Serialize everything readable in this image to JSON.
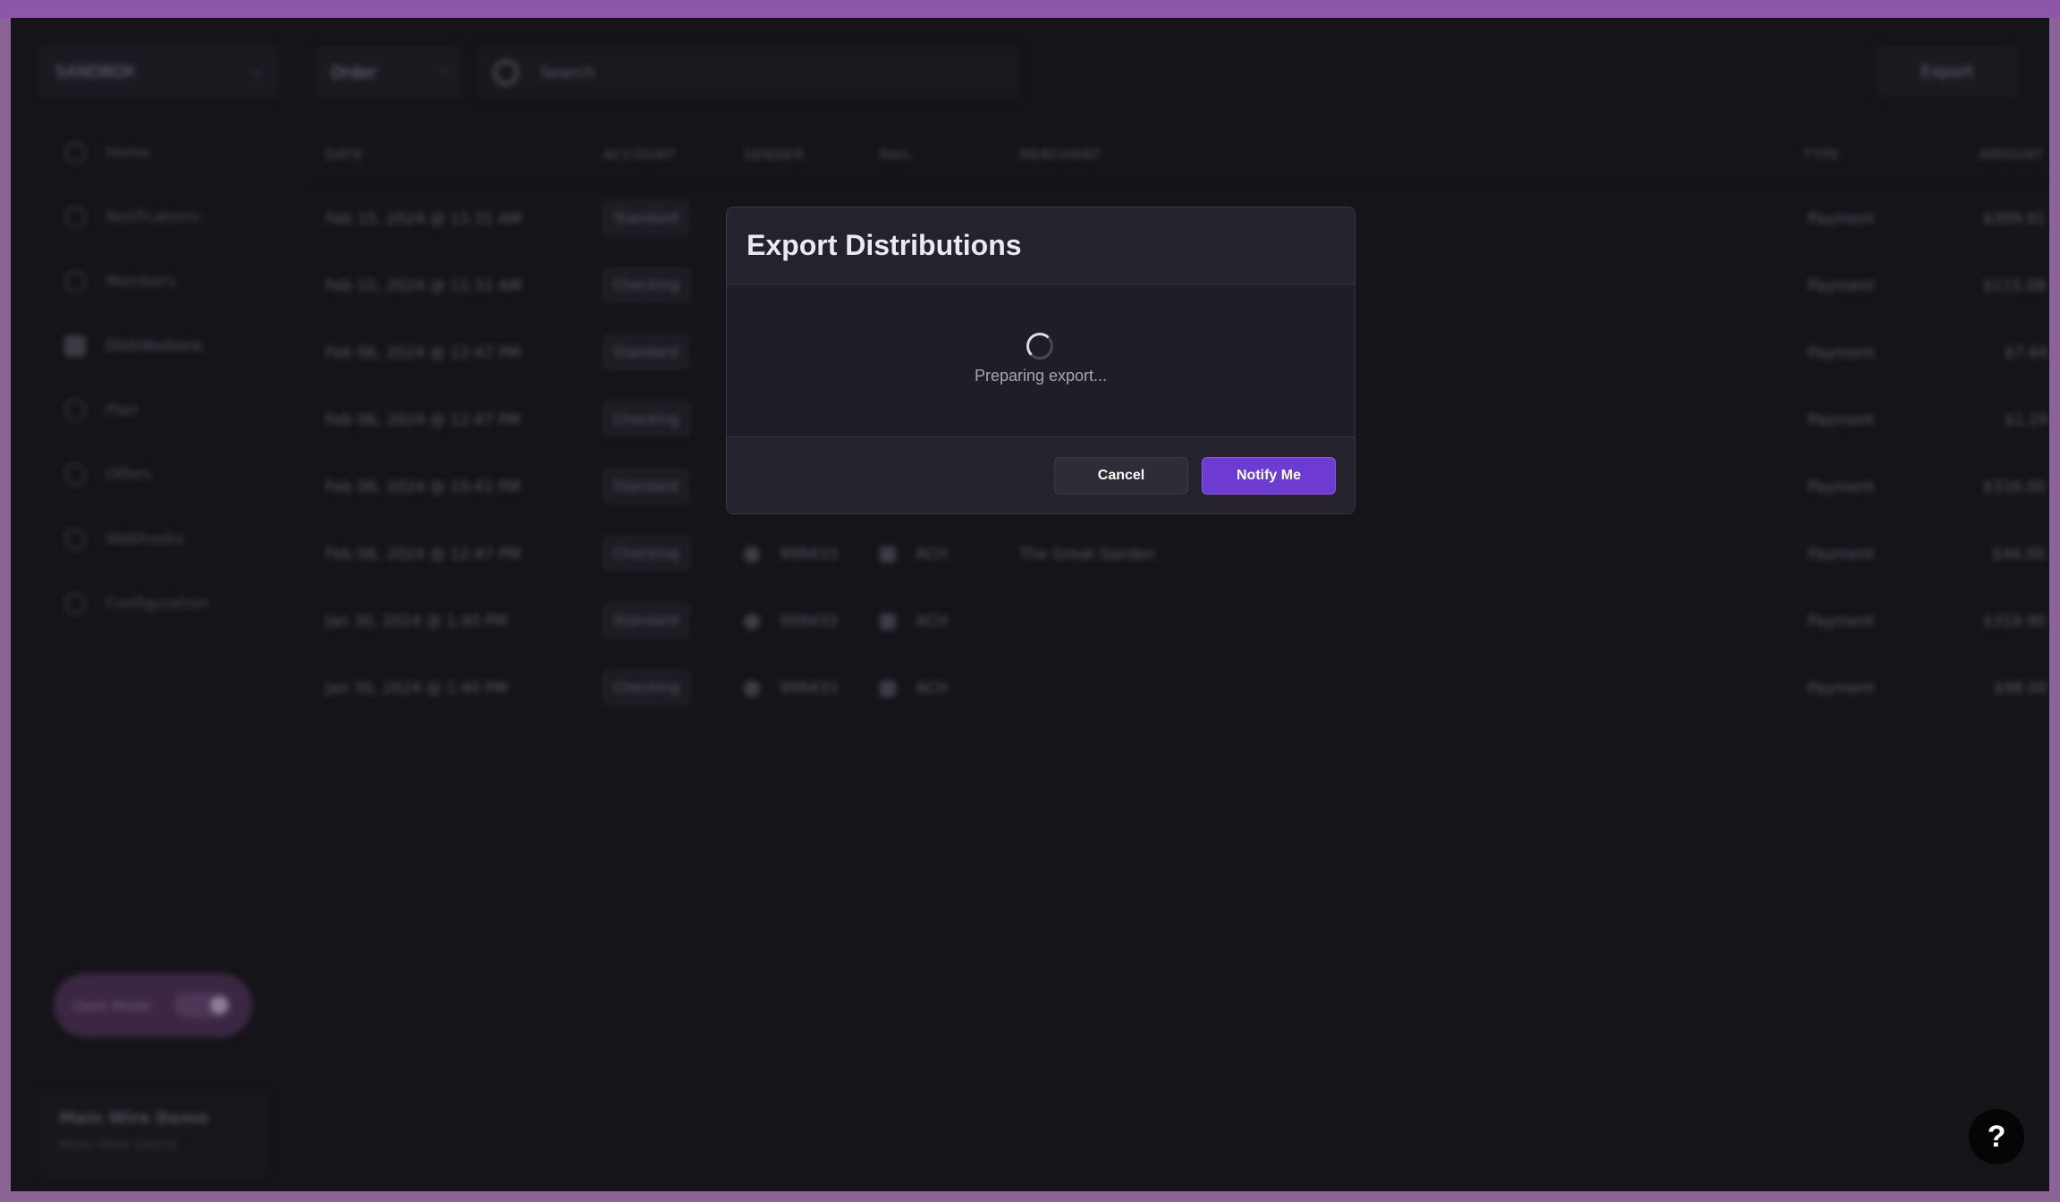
{
  "background": {
    "workspace_select": "SANDBOX",
    "order_select": "Order",
    "search_placeholder": "Search",
    "export_label": "Export",
    "nav": [
      {
        "label": "Home",
        "icon": "home-icon"
      },
      {
        "label": "Notifications",
        "icon": "bell-icon"
      },
      {
        "label": "Members",
        "icon": "members-icon"
      },
      {
        "label": "Distributions",
        "icon": "distributions-icon"
      },
      {
        "label": "Plan",
        "icon": "plan-icon"
      },
      {
        "label": "Offers",
        "icon": "offers-icon"
      },
      {
        "label": "Webhooks",
        "icon": "webhooks-icon"
      },
      {
        "label": "Configuration",
        "icon": "configuration-icon"
      }
    ],
    "columns": [
      "DATE",
      "ACCOUNT",
      "SENDER",
      "RAIL",
      "MERCHANT",
      "TYPE",
      "AMOUNT"
    ],
    "rows": [
      {
        "date": "Feb 15, 2024 @ 11:31 AM",
        "account": "Standard",
        "sender": "",
        "rail": "",
        "merchant": "",
        "type": "Payment",
        "amount": "$309.91"
      },
      {
        "date": "Feb 15, 2024 @ 11:31 AM",
        "account": "Checking",
        "sender": "",
        "rail": "",
        "merchant": "",
        "type": "Payment",
        "amount": "$115.08"
      },
      {
        "date": "Feb 06, 2024 @ 12:47 PM",
        "account": "Standard",
        "sender": "",
        "rail": "",
        "merchant": "",
        "type": "Payment",
        "amount": "$7.84"
      },
      {
        "date": "Feb 06, 2024 @ 12:47 PM",
        "account": "Checking",
        "sender": "",
        "rail": "",
        "merchant": "",
        "type": "Payment",
        "amount": "$1.29"
      },
      {
        "date": "Feb 06, 2024 @ 10:41 PM",
        "account": "Standard",
        "sender": "",
        "rail": "",
        "merchant": "",
        "type": "Payment",
        "amount": "$316.00"
      },
      {
        "date": "Feb 06, 2024 @ 12:47 PM",
        "account": "Checking",
        "sender": "999433",
        "rail": "ACH",
        "merchant": "The Great Garden",
        "type": "Payment",
        "amount": "$44.00"
      },
      {
        "date": "Jan 30, 2024 @ 1:40 PM",
        "account": "Standard",
        "sender": "999433",
        "rail": "ACH",
        "merchant": "",
        "type": "Payment",
        "amount": "$319.90"
      },
      {
        "date": "Jan 30, 2024 @ 1:40 PM",
        "account": "Checking",
        "sender": "999433",
        "rail": "ACH",
        "merchant": "",
        "type": "Payment",
        "amount": "$98.00"
      }
    ],
    "dark_mode_label": "Dark Mode",
    "user_name": "Main Wire Demo",
    "user_subtitle": "Main Wire Demo"
  },
  "modal": {
    "title": "Export Distributions",
    "loading_text": "Preparing export...",
    "cancel_label": "Cancel",
    "notify_label": "Notify Me"
  },
  "help_label": "?",
  "colors": {
    "accent": "#6d3bd1",
    "frame": "#8d56a8",
    "app_bg": "#151419",
    "modal_bg": "#26222d"
  }
}
